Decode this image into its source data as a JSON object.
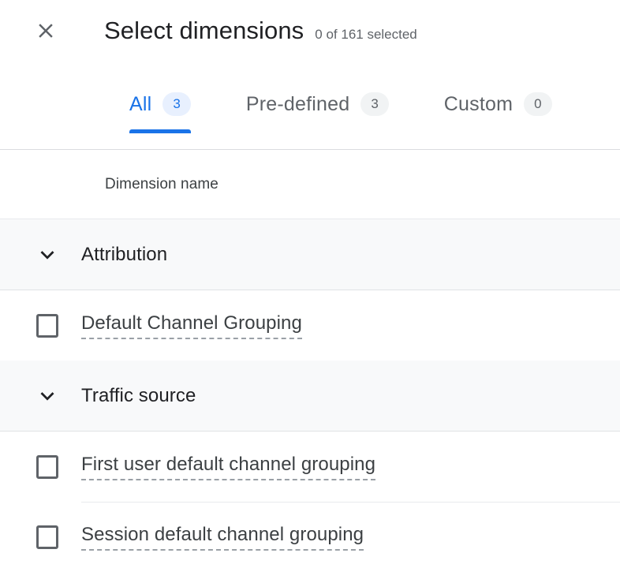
{
  "header": {
    "close_icon": "close-icon",
    "title": "Select dimensions",
    "selection_count": "0 of 161 selected"
  },
  "tabs": [
    {
      "label": "All",
      "badge": "3",
      "active": true
    },
    {
      "label": "Pre-defined",
      "badge": "3",
      "active": false
    },
    {
      "label": "Custom",
      "badge": "0",
      "active": false
    }
  ],
  "table": {
    "column_header": "Dimension name",
    "groups": [
      {
        "label": "Attribution",
        "chevron_icon": "chevron-down-icon",
        "items": [
          {
            "label": "Default Channel Grouping",
            "checked": false
          }
        ]
      },
      {
        "label": "Traffic source",
        "chevron_icon": "chevron-down-icon",
        "items": [
          {
            "label": "First user default channel grouping",
            "checked": false
          },
          {
            "label": "Session default channel grouping",
            "checked": false
          }
        ]
      }
    ]
  },
  "colors": {
    "accent": "#1a73e8",
    "accent_badge_bg": "#e8f0fe",
    "badge_bg": "#f1f3f4",
    "text_primary": "#202124",
    "text_secondary": "#5f6368",
    "group_row_bg": "#f8f9fa",
    "divider": "#e8eaed"
  }
}
